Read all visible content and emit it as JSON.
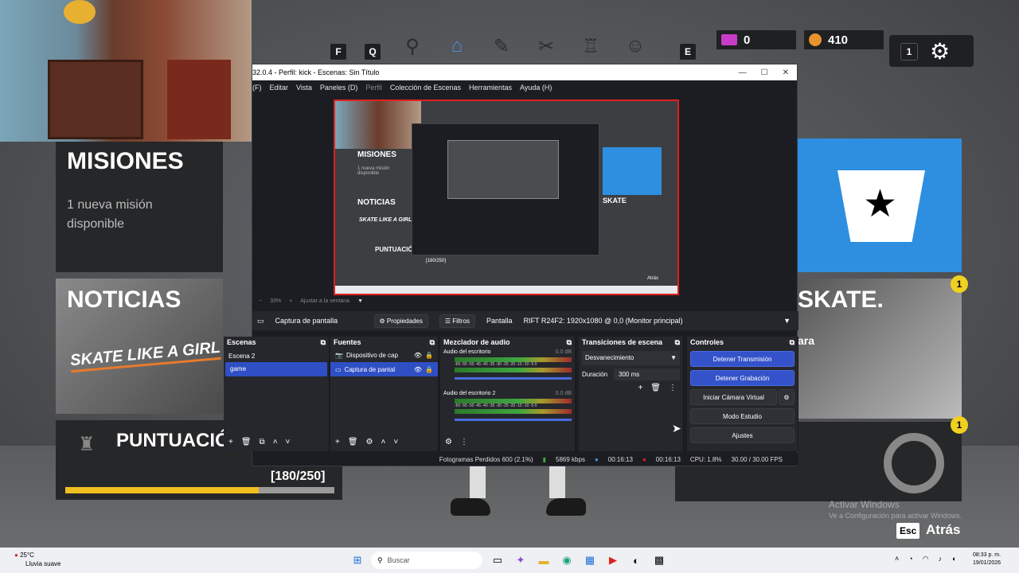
{
  "hud": {
    "keys": [
      "F",
      "Q",
      "E",
      "1"
    ],
    "gems": "0",
    "coins": "410",
    "slot_key": "1"
  },
  "cards": {
    "misiones": {
      "title": "MISIONES",
      "subtitle": "1 nueva misión disponible"
    },
    "noticias": {
      "title": "NOTICIAS",
      "banner": "SKATE LIKE A GIRL"
    },
    "puntuacion": {
      "title": "PUNTUACIÓ",
      "progress_text": "[180/250]",
      "progress": 0.72
    },
    "skate": {
      "title": "SKATE.",
      "sub": "ara"
    },
    "badges": [
      "1",
      "1"
    ]
  },
  "activate": {
    "title": "Activar Windows",
    "sub": "Ve a Configuración para activar Windows."
  },
  "back": {
    "key": "Esc",
    "label": "Atrás"
  },
  "obs": {
    "window_title": "32.0.4 - Perfil: kick - Escenas: Sin Título",
    "menu": [
      "(F)",
      "Editar",
      "Vista",
      "Paneles (D)",
      "Perfil",
      "Colección de Escenas",
      "Herramientas",
      "Ayuda (H)"
    ],
    "zoom": "33%",
    "fit": "Ajustar a la ventana",
    "preview": {
      "misiones": "MISIONES",
      "misiones_sub": "1 nueva misión disponible",
      "noticias": "NOTICIAS",
      "banner": "SKATE LIKE A GIRL",
      "puntuacion": "PUNTUACIÓ",
      "progress": "[180/250]",
      "skate": "SKATE",
      "back": "Atrás"
    },
    "source_bar": {
      "source": "Captura de pantalla",
      "properties": "Propiedades",
      "filters": "Filtros",
      "display_label": "Pantalla",
      "display_value": "RIFT R24F2: 1920x1080 @ 0,0 (Monitor principal)"
    },
    "scenes": {
      "title": "Escenas",
      "items": [
        "Escena 2",
        "game"
      ],
      "selected": "game"
    },
    "sources": {
      "title": "Fuentes",
      "items": [
        "Dispositivo de cap",
        "Captura de pantal"
      ]
    },
    "mixer": {
      "title": "Mezclador de audio",
      "channels": [
        {
          "name": "Audio del escritorio",
          "db": "0.0 dB"
        },
        {
          "name": "Audio del escritorio 2",
          "db": "0.0 dB"
        }
      ],
      "scale": "-60 -55 -50 -45 -40 -35 -30 -25 -20 -15 -10 -5 0"
    },
    "transitions": {
      "title": "Transiciones de escena",
      "type": "Desvanecimiento",
      "duration_label": "Duración",
      "duration_value": "300 ms"
    },
    "controls": {
      "title": "Controles",
      "stop_stream": "Detener Transmisión",
      "stop_rec": "Detener Grabación",
      "virtual_cam": "Iniciar Cámara Virtual",
      "studio": "Modo Estudio",
      "settings": "Ajustes"
    },
    "status": {
      "dropped": "Fotogramas Perdidos 600 (2.1%)",
      "bitrate": "5869 kbps",
      "stream_time": "00:16:13",
      "rec_time": "00:16:13",
      "cpu": "CPU: 1.8%",
      "fps": "30.00 / 30.00 FPS"
    }
  },
  "taskbar": {
    "weather_temp": "25°C",
    "weather_desc": "Lluvia suave",
    "search": "Buscar",
    "time": "08:33 p. m.",
    "date": "19/01/2026"
  }
}
